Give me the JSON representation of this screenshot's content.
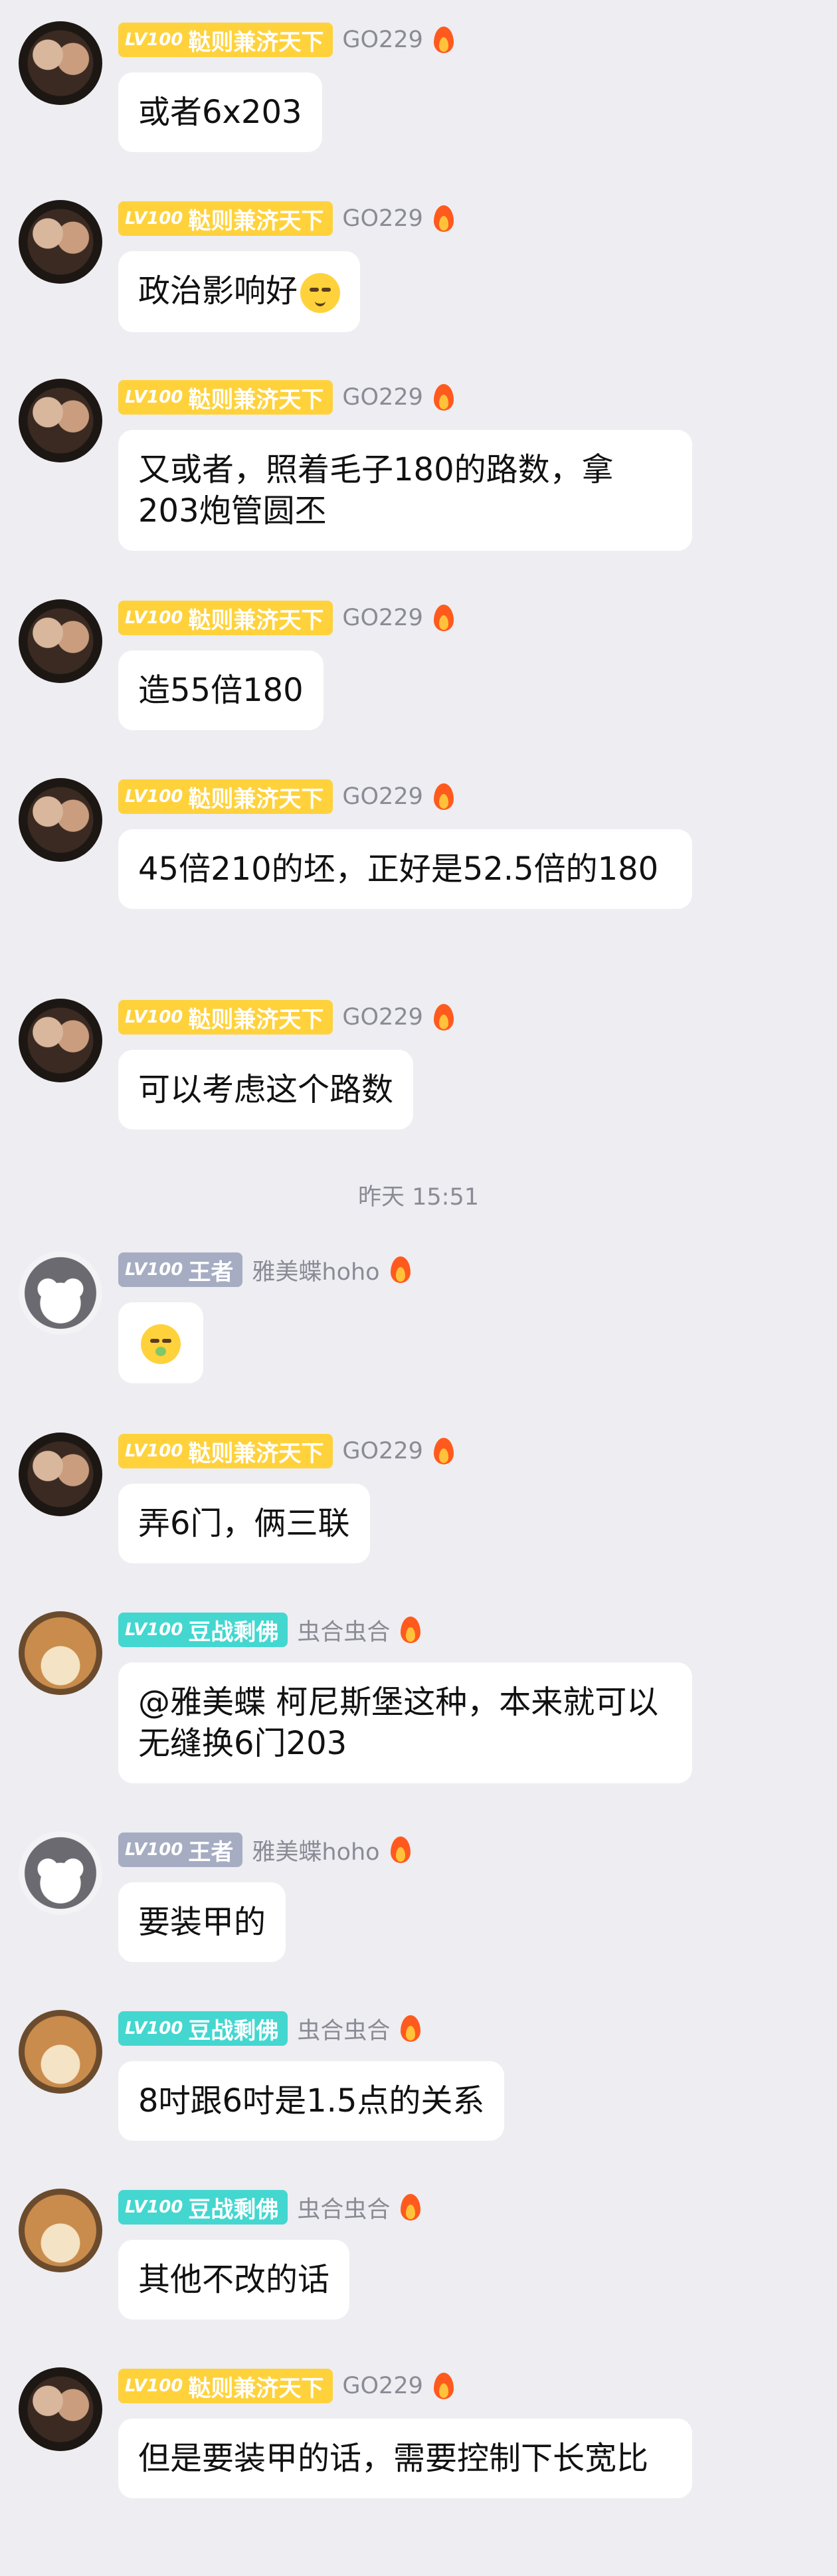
{
  "badges": {
    "lv": "LV100",
    "bianze": "鞑则兼济天下",
    "wangzhe": "王者",
    "douzhan": "豆战剩佛"
  },
  "users": {
    "go229": "GO229",
    "yameidie": "雅美蝶hoho",
    "chonghe": "虫合虫合"
  },
  "timestamp": "昨天 15:51",
  "messages": [
    {
      "text": "或者6x203"
    },
    {
      "text": "政治影响好"
    },
    {
      "text": "又或者，照着毛子180的路数，拿203炮管圆丕"
    },
    {
      "text": "造55倍180"
    },
    {
      "text": "45倍210的坯，正好是52.5倍的180"
    },
    {
      "text": "可以考虑这个路数"
    },
    {
      "text": ""
    },
    {
      "text": "弄6门，俩三联"
    },
    {
      "text": "@雅美蝶 柯尼斯堡这种，本来就可以无缝换6门203"
    },
    {
      "text": "要装甲的"
    },
    {
      "text": "8吋跟6吋是1.5点的关系"
    },
    {
      "text": "其他不改的话"
    },
    {
      "text": "但是要装甲的话，需要控制下长宽比"
    }
  ],
  "icons": {
    "fire": "fire-icon",
    "smile_emoji": "smiling-face-emoji",
    "sick_emoji": "nauseated-face-emoji"
  }
}
